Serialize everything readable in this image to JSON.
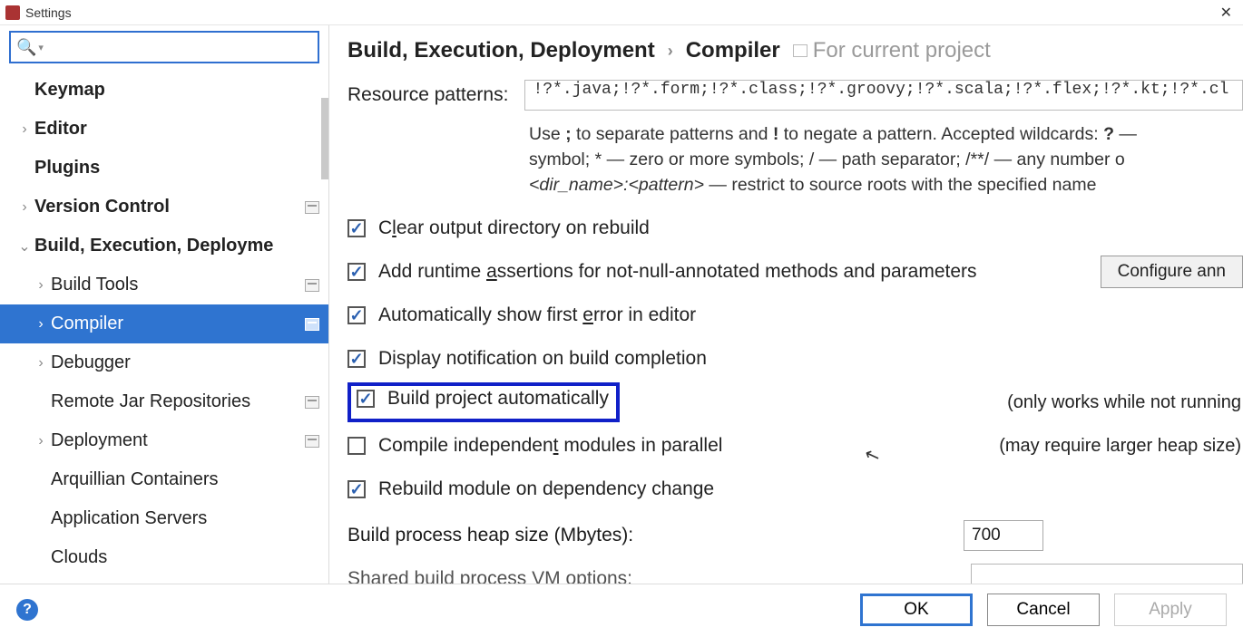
{
  "window": {
    "title": "Settings"
  },
  "search": {
    "placeholder": ""
  },
  "tree": {
    "keymap": "Keymap",
    "editor": "Editor",
    "plugins": "Plugins",
    "version_control": "Version Control",
    "build": "Build, Execution, Deployme",
    "build_tools": "Build Tools",
    "compiler": "Compiler",
    "debugger": "Debugger",
    "remote_jar": "Remote Jar Repositories",
    "deployment": "Deployment",
    "arquillian": "Arquillian Containers",
    "app_servers": "Application Servers",
    "clouds": "Clouds"
  },
  "breadcrumb": {
    "a": "Build, Execution, Deployment",
    "b": "Compiler",
    "for_project": "For current project"
  },
  "form": {
    "resource_patterns_label": "Resource patterns:",
    "resource_patterns_value": "!?*.java;!?*.form;!?*.class;!?*.groovy;!?*.scala;!?*.flex;!?*.kt;!?*.cl",
    "hint_line1_a": "Use ",
    "hint_line1_b": " to separate patterns and ",
    "hint_line1_c": " to negate a pattern. Accepted wildcards: ",
    "hint_line1_d": " —",
    "hint_line2": "symbol; * — zero or more symbols; / — path separator; /**/ — any number o",
    "hint_line3a": "<dir_name>:<pattern>",
    "hint_line3b": " — restrict to source roots with the specified name",
    "clear_output": "Clear output directory on rebuild",
    "add_runtime": "Add runtime assertions for not-null-annotated methods and parameters",
    "configure_btn": "Configure ann",
    "auto_show_error": "Automatically show first error in editor",
    "display_notif": "Display notification on build completion",
    "build_auto": "Build project automatically",
    "build_auto_trail": "(only works while not running",
    "compile_parallel": "Compile independent modules in parallel",
    "compile_parallel_trail": "(may require larger heap size)",
    "rebuild_dep": "Rebuild module on dependency change",
    "heap_label": "Build process heap size (Mbytes):",
    "heap_value": "700",
    "vm_label": "Shared build process VM options:"
  },
  "footer": {
    "ok": "OK",
    "cancel": "Cancel",
    "apply": "Apply"
  }
}
